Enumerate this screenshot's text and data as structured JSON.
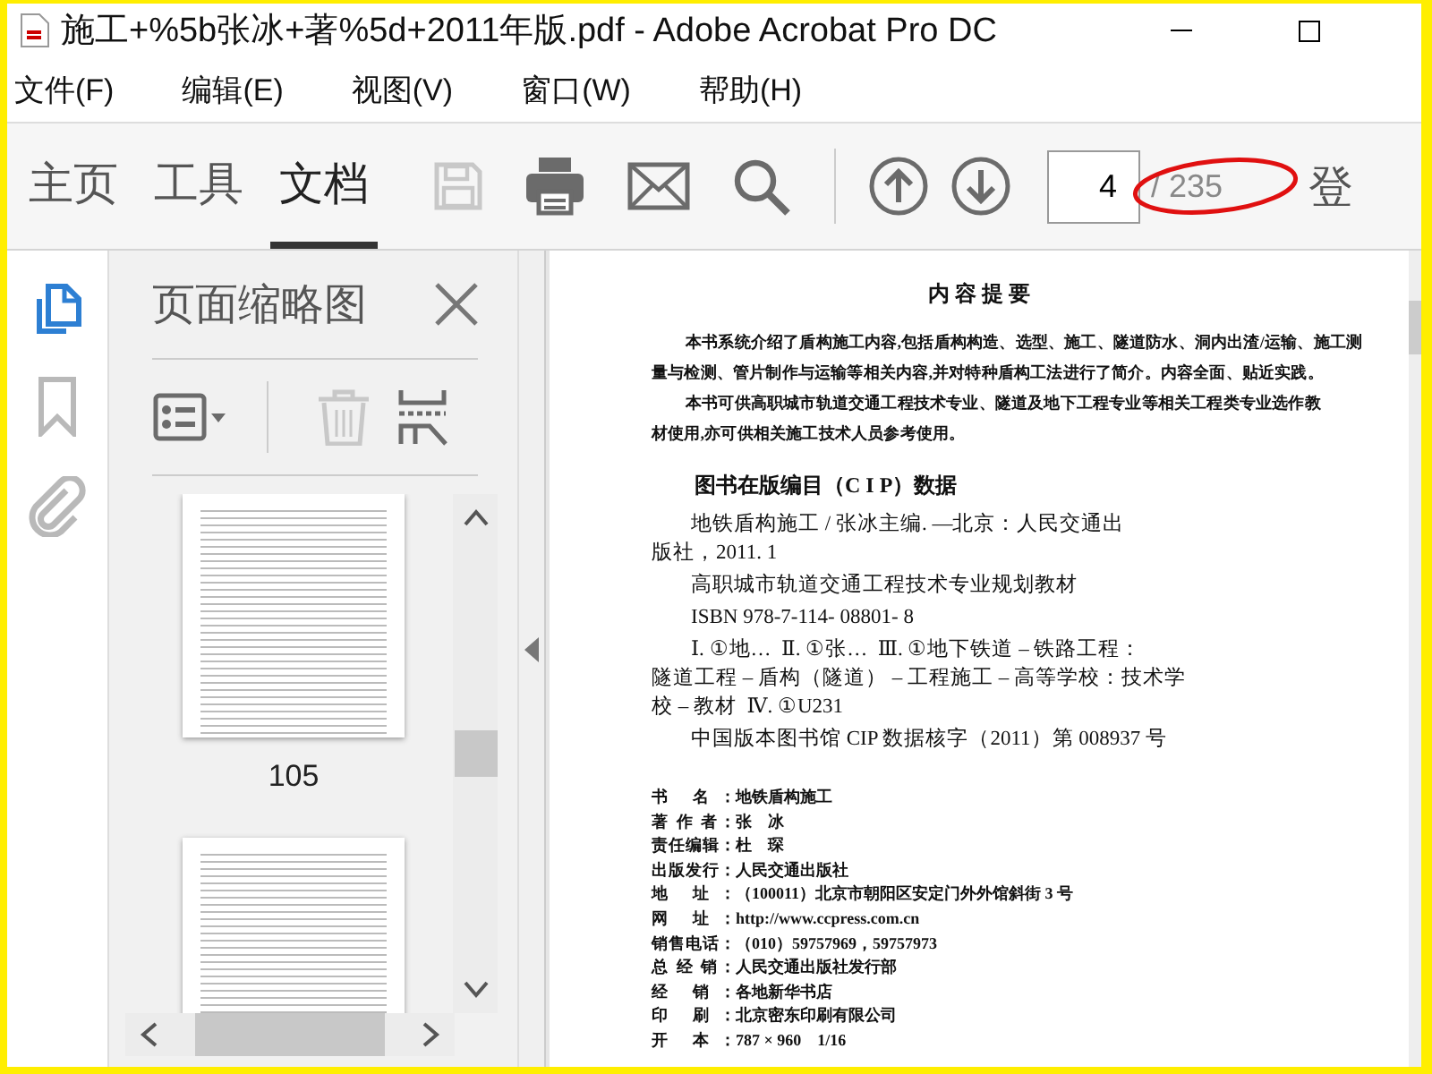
{
  "window": {
    "title": "施工+%5b张冰+著%5d+2011年版.pdf - Adobe Acrobat Pro DC"
  },
  "menu": [
    {
      "label": "文件(F)"
    },
    {
      "label": "编辑(E)"
    },
    {
      "label": "视图(V)"
    },
    {
      "label": "窗口(W)"
    },
    {
      "label": "帮助(H)"
    }
  ],
  "toolbar": {
    "tabs": [
      {
        "label": "主页",
        "selected": false
      },
      {
        "label": "工具",
        "selected": false
      },
      {
        "label": "文档",
        "selected": true
      }
    ],
    "tools": [
      {
        "kind": "save",
        "disabled": true
      },
      {
        "kind": "print",
        "disabled": false
      },
      {
        "kind": "mail",
        "disabled": false
      },
      {
        "kind": "search",
        "disabled": false
      }
    ],
    "nav": [
      {
        "kind": "up"
      },
      {
        "kind": "down"
      }
    ],
    "page_input": {
      "value": "4"
    },
    "page_total": "/ 235",
    "page_total_circled": true,
    "sign_in": "登"
  },
  "nav_rail": [
    {
      "kind": "pages",
      "selected": true
    },
    {
      "kind": "bookmarks",
      "selected": false
    },
    {
      "kind": "attachments",
      "selected": false
    }
  ],
  "thumbnail_panel": {
    "title": "页面缩略图",
    "tools": [
      {
        "kind": "options",
        "disabled": false
      },
      {
        "kind": "delete",
        "disabled": true
      },
      {
        "kind": "extract",
        "disabled": false
      }
    ],
    "thumbnails": [
      {
        "label": "105",
        "selected": false
      },
      {
        "selected": false
      }
    ]
  },
  "document": {
    "heading": "内 容 提 要",
    "paragraphs": [
      {
        "lines": [
          "本书系统介绍了盾构施工内容,包括盾构构造、选型、施工、隧道防水、洞内出渣/运输、施工测",
          "量与检测、管片制作与运输等相关内容,并对特种盾构工法进行了简介。内容全面、贴近实践。"
        ]
      },
      {
        "lines": [
          "本书可供高职城市轨道交通工程技术专业、隧道及地下工程专业等相关工程类专业选作教",
          "材使用,亦可供相关施工技术人员参考使用。"
        ]
      }
    ],
    "cip_heading": "图书在版编目（C I P）数据",
    "cip_paragraphs": [
      {
        "lines": [
          "地铁盾构施工 / 张冰主编. —北京：人民交通出",
          "版社，2011. 1"
        ]
      },
      {
        "lines": [
          "高职城市轨道交通工程技术专业规划教材"
        ]
      },
      {
        "lines": [
          "ISBN 978-7-114- 08801- 8"
        ]
      },
      {
        "lines": [
          "Ⅰ. ①地…  Ⅱ. ①张…  Ⅲ. ①地下铁道 – 铁路工程：",
          "隧道工程 – 盾构（隧道） – 工程施工 – 高等学校：技术学",
          "校 – 教材  Ⅳ. ①U231"
        ]
      },
      {
        "lines": [
          "中国版本图书馆 CIP 数据核字（2011）第 008937 号"
        ]
      }
    ],
    "colophon": [
      {
        "label": "书 名：",
        "value": "地铁盾构施工"
      },
      {
        "label": "著 作 者：",
        "value": "张　冰"
      },
      {
        "label": "责任编辑：",
        "value": "杜　琛"
      },
      {
        "label": "出版发行：",
        "value": "人民交通出版社"
      },
      {
        "label": "地 址：",
        "value": "（100011）北京市朝阳区安定门外外馆斜街 3 号"
      },
      {
        "label": "网 址：",
        "value": "http://www.ccpress.com.cn"
      },
      {
        "label": "销售电话：",
        "value": "（010）59757969，59757973"
      },
      {
        "label": "总 经 销：",
        "value": "人民交通出版社发行部"
      },
      {
        "label": "经 销：",
        "value": "各地新华书店"
      },
      {
        "label": "印 刷：",
        "value": "北京密东印刷有限公司"
      },
      {
        "label": "开 本：",
        "value": "787 × 960　1/16"
      }
    ]
  }
}
